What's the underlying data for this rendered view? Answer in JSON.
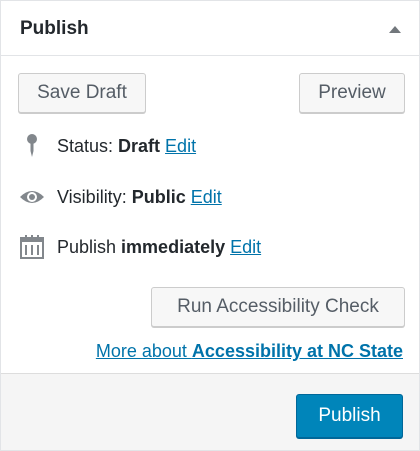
{
  "panel": {
    "title": "Publish"
  },
  "actions": {
    "save_draft_label": "Save Draft",
    "preview_label": "Preview"
  },
  "status": {
    "label": "Status: ",
    "value": "Draft",
    "edit_label": "Edit",
    "icon": "pin-icon"
  },
  "visibility": {
    "label": "Visibility: ",
    "value": "Public",
    "edit_label": "Edit",
    "icon": "eye-icon"
  },
  "schedule": {
    "label": "Publish ",
    "value": "immediately",
    "edit_label": "Edit",
    "icon": "calendar-icon"
  },
  "accessibility": {
    "check_label": "Run Accessibility Check",
    "link_prefix": "More about ",
    "link_bold": "Accessibility at NC State"
  },
  "footer": {
    "publish_label": "Publish"
  },
  "colors": {
    "link": "#0073aa",
    "primary": "#0085ba",
    "icon": "#82878c"
  }
}
